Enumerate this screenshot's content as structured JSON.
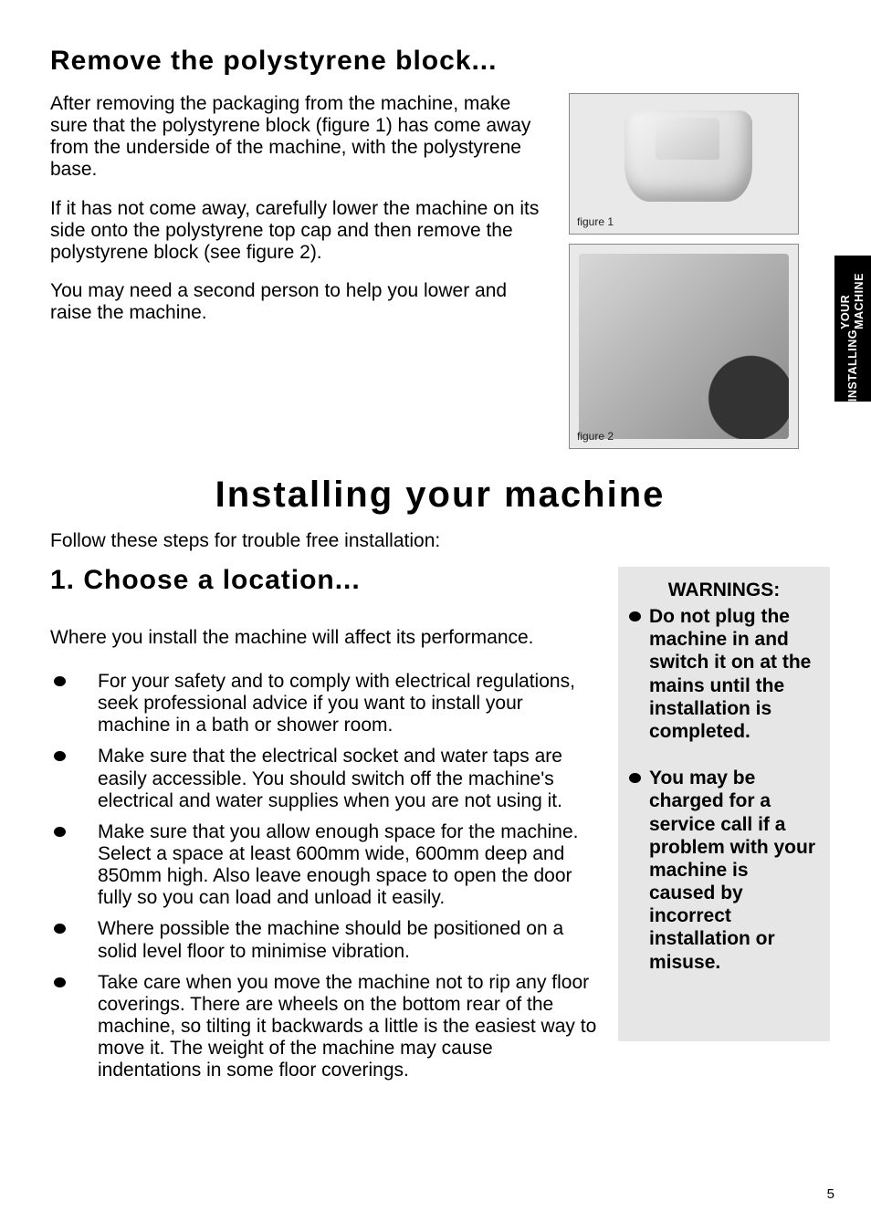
{
  "side_tab": {
    "line1": "INSTALLING",
    "line2": "YOUR MACHINE"
  },
  "section1": {
    "heading": "Remove the polystyrene block...",
    "p1": "After removing the packaging from the machine, make sure that the polystyrene block (figure 1) has come away from the underside of the machine, with the polystyrene base.",
    "p2": "If it has not come away, carefully lower the machine on its side onto the polystyrene top cap and then remove the polystyrene block (see figure 2).",
    "p3": "You may need a second person to help you lower and raise the machine."
  },
  "figures": {
    "fig1_label": "figure 1",
    "fig2_label": "figure 2"
  },
  "main_heading": "Installing your machine",
  "follow_line": "Follow these steps for trouble free installation:",
  "section2": {
    "heading": "1.  Choose a location...",
    "where_line": "Where you install the machine will affect its performance.",
    "bullets": [
      "For your safety and to comply with electrical regulations, seek professional advice if you want to install your machine in a bath or shower room.",
      "Make sure that the electrical socket and water taps are easily accessible.  You  should switch off the machine's electrical and water supplies when you are not using it.",
      "Make sure that you allow enough space for the machine.  Select a space at least 600mm wide, 600mm deep and 850mm high.  Also leave  enough space to open the door fully so you can load and unload it easily.",
      "Where possible the machine should be positioned on a solid level floor to minimise vibration.",
      "Take care when you move the machine not to rip any floor coverings.  There are wheels on the bottom rear of the machine, so tilting it backwards a little is the easiest way to move it.  The weight of  the machine may cause indentations in some  floor coverings."
    ]
  },
  "warnings": {
    "title": "WARNINGS:",
    "items": [
      "Do not plug the machine in and switch it on at the mains until the installation is completed.",
      "You may be charged for a service call if a problem with your machine is caused by incorrect installation or misuse."
    ]
  },
  "page_number": "5"
}
